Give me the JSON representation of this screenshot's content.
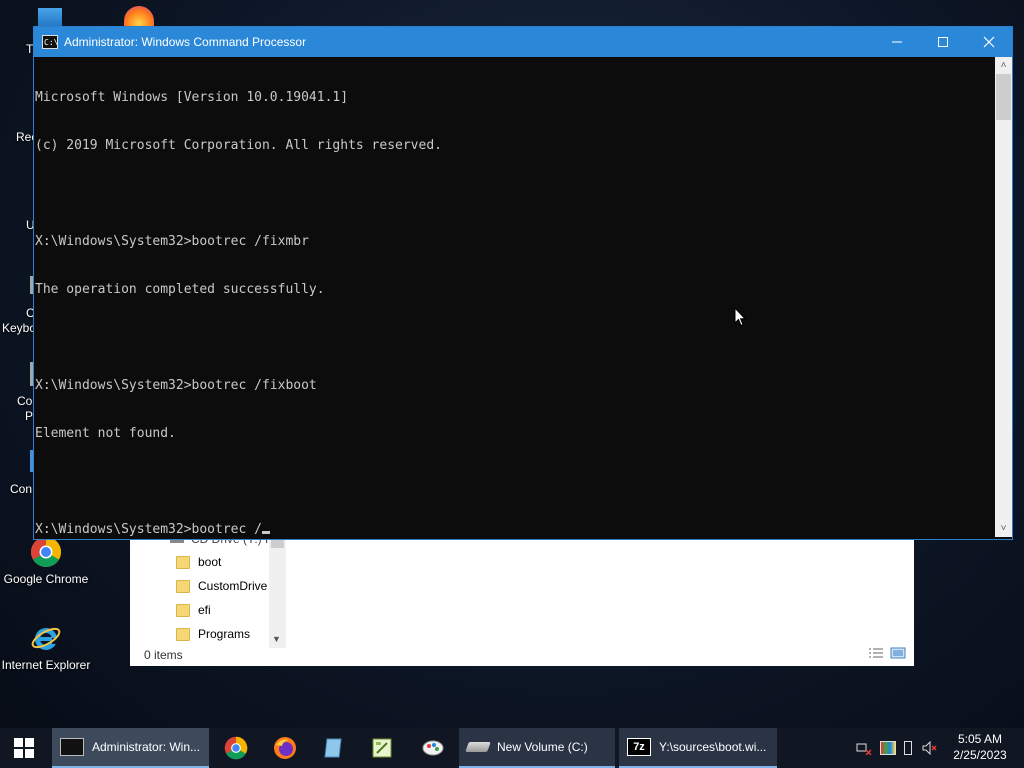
{
  "desktop": {
    "icons": [
      {
        "label": "Google Chrome",
        "icon": "chrome-icon"
      },
      {
        "label": "Internet Explorer",
        "icon": "internet-explorer-icon"
      }
    ],
    "partial_labels": [
      "T",
      "Rec",
      "U",
      "C",
      "Keybo",
      "Co",
      "P",
      "Con"
    ]
  },
  "explorer": {
    "partial_tree_header": "CD Drive (Y:) H",
    "folders": [
      "boot",
      "CustomDrive",
      "efi",
      "Programs"
    ],
    "status": "0 items"
  },
  "cmd": {
    "title": "Administrator: Windows Command Processor",
    "lines": [
      "Microsoft Windows [Version 10.0.19041.1]",
      "(c) 2019 Microsoft Corporation. All rights reserved.",
      "",
      "X:\\Windows\\System32>bootrec /fixmbr",
      "The operation completed successfully.",
      "",
      "X:\\Windows\\System32>bootrec /fixboot",
      "Element not found.",
      ""
    ],
    "prompt_line": "X:\\Windows\\System32>bootrec /"
  },
  "taskbar": {
    "tasks": [
      {
        "label": "Administrator: Win...",
        "icon": "cmd-icon"
      },
      {
        "label": "New Volume (C:)",
        "icon": "drive-icon"
      },
      {
        "label": "Y:\\sources\\boot.wi...",
        "icon": "7zip-icon"
      }
    ],
    "seven_zip_icon_text": "7z",
    "pinned": [
      "chrome-icon",
      "firefox-icon",
      "notepad-icon",
      "notepad-plus-icon",
      "paint-icon"
    ],
    "clock": {
      "time": "5:05 AM",
      "date": "2/25/2023"
    }
  },
  "colors": {
    "titlebar": "#2b88d8",
    "console_bg": "#0c0c0c",
    "console_fg": "#c8c8c8",
    "taskbar": "#101722"
  }
}
